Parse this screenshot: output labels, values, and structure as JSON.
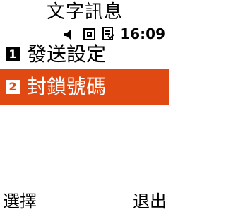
{
  "header": {
    "title": "文字訊息"
  },
  "status": {
    "time": "16:09",
    "icons": [
      "speaker-icon",
      "message-counter-icon",
      "document-icon"
    ]
  },
  "menu": {
    "items": [
      {
        "number": "1",
        "label": "發送設定",
        "selected": false
      },
      {
        "number": "2",
        "label": "封鎖號碼",
        "selected": true
      }
    ]
  },
  "softkeys": {
    "left": "選擇",
    "right": "退出"
  },
  "colors": {
    "highlight": "#e04a12",
    "background": "#ffffff",
    "text": "#000000"
  }
}
